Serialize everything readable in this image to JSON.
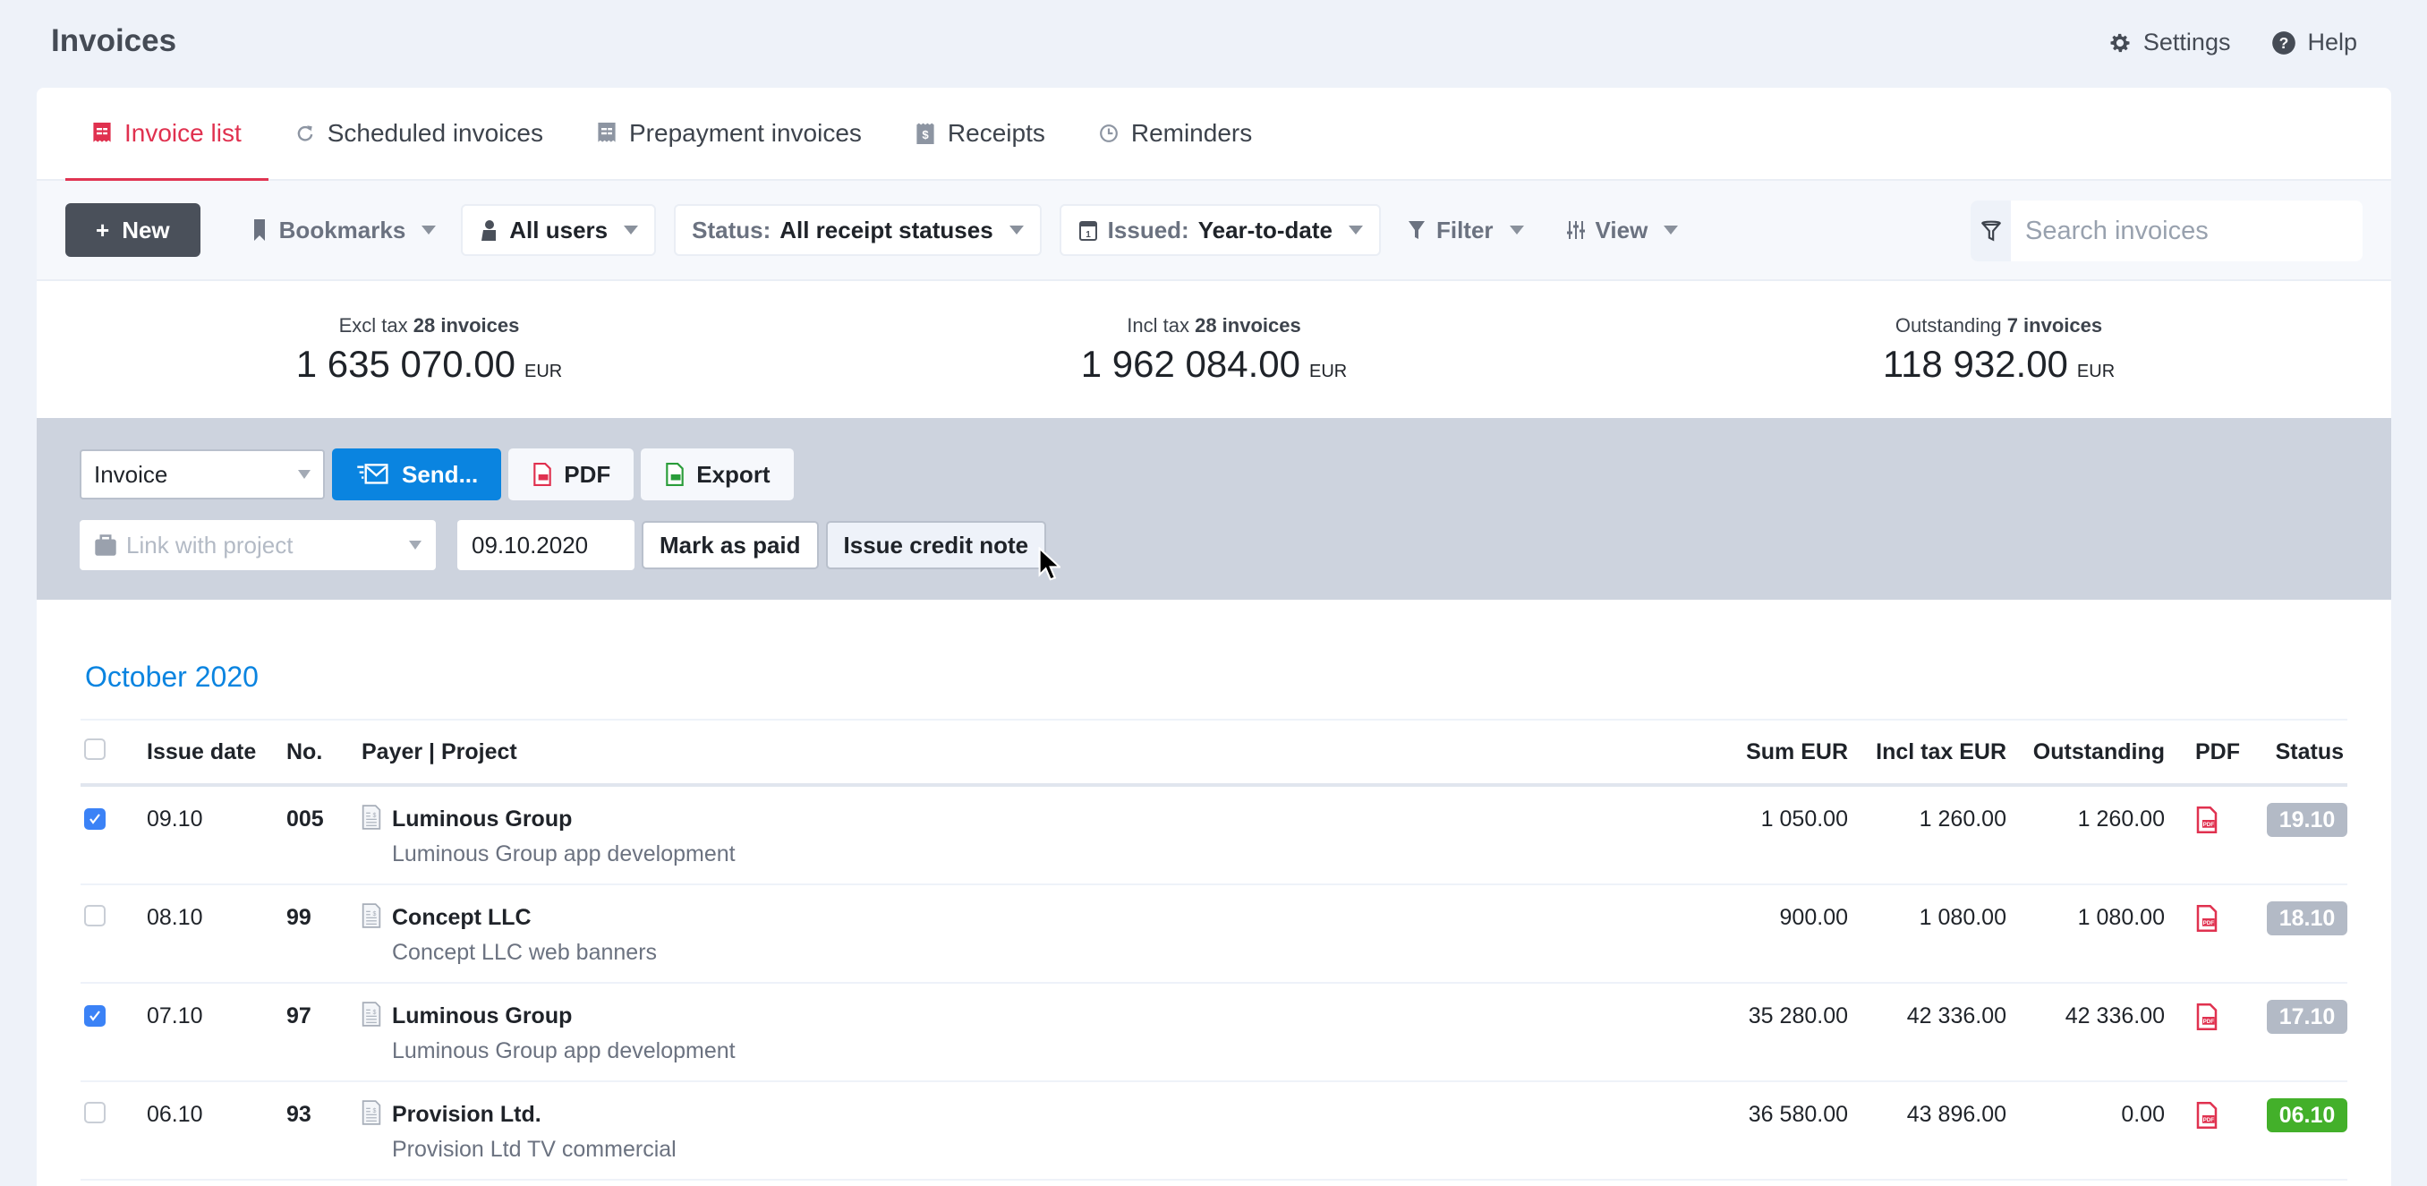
{
  "header": {
    "title": "Invoices",
    "links": [
      {
        "label": "Settings",
        "icon": "gear-icon"
      },
      {
        "label": "Help",
        "icon": "help-icon"
      }
    ]
  },
  "tabs": [
    {
      "label": "Invoice list",
      "icon": "invoice-icon",
      "active": true
    },
    {
      "label": "Scheduled invoices",
      "icon": "refresh-icon",
      "active": false
    },
    {
      "label": "Prepayment invoices",
      "icon": "invoice-icon",
      "active": false
    },
    {
      "label": "Receipts",
      "icon": "receipt-icon",
      "active": false
    },
    {
      "label": "Reminders",
      "icon": "clock-icon",
      "active": false
    }
  ],
  "toolbar": {
    "new_label": "New",
    "bookmarks_label": "Bookmarks",
    "users_label": "All users",
    "status_prefix": "Status:",
    "status_value": "All receipt statuses",
    "issued_prefix": "Issued:",
    "issued_value": "Year-to-date",
    "filter_label": "Filter",
    "view_label": "View",
    "search_placeholder": "Search invoices"
  },
  "summary": [
    {
      "label": "Excl tax",
      "count": "28 invoices",
      "value": "1 635 070.00",
      "currency": "EUR"
    },
    {
      "label": "Incl tax",
      "count": "28 invoices",
      "value": "1 962 084.00",
      "currency": "EUR"
    },
    {
      "label": "Outstanding",
      "count": "7 invoices",
      "value": "118 932.00",
      "currency": "EUR"
    }
  ],
  "actions": {
    "doc_type": "Invoice",
    "send_label": "Send...",
    "pdf_label": "PDF",
    "export_label": "Export",
    "project_placeholder": "Link with project",
    "date_value": "09.10.2020",
    "mark_paid_label": "Mark as paid",
    "credit_note_label": "Issue credit note"
  },
  "month_heading": "October 2020",
  "table": {
    "columns": {
      "issue_date": "Issue date",
      "no": "No.",
      "payer": "Payer | Project",
      "sum": "Sum EUR",
      "incl": "Incl tax EUR",
      "outstanding": "Outstanding",
      "pdf": "PDF",
      "status": "Status"
    },
    "rows": [
      {
        "checked": true,
        "date": "09.10",
        "no": "005",
        "payer": "Luminous Group",
        "project": "Luminous Group app development",
        "sum": "1 050.00",
        "incl": "1 260.00",
        "outstanding": "1 260.00",
        "status": "19.10",
        "status_color": "#b3bac6"
      },
      {
        "checked": false,
        "date": "08.10",
        "no": "99",
        "payer": "Concept LLC",
        "project": "Concept LLC web banners",
        "sum": "900.00",
        "incl": "1 080.00",
        "outstanding": "1 080.00",
        "status": "18.10",
        "status_color": "#b3bac6"
      },
      {
        "checked": true,
        "date": "07.10",
        "no": "97",
        "payer": "Luminous Group",
        "project": "Luminous Group app development",
        "sum": "35 280.00",
        "incl": "42 336.00",
        "outstanding": "42 336.00",
        "status": "17.10",
        "status_color": "#b3bac6"
      },
      {
        "checked": false,
        "date": "06.10",
        "no": "93",
        "payer": "Provision Ltd.",
        "project": "Provision Ltd TV commercial",
        "sum": "36 580.00",
        "incl": "43 896.00",
        "outstanding": "0.00",
        "status": "06.10",
        "status_color": "#43b02a"
      }
    ]
  },
  "colors": {
    "accent_red": "#e03452",
    "primary_blue": "#0a84e0",
    "paid_green": "#43b02a",
    "pending_gray": "#b3bac6"
  }
}
